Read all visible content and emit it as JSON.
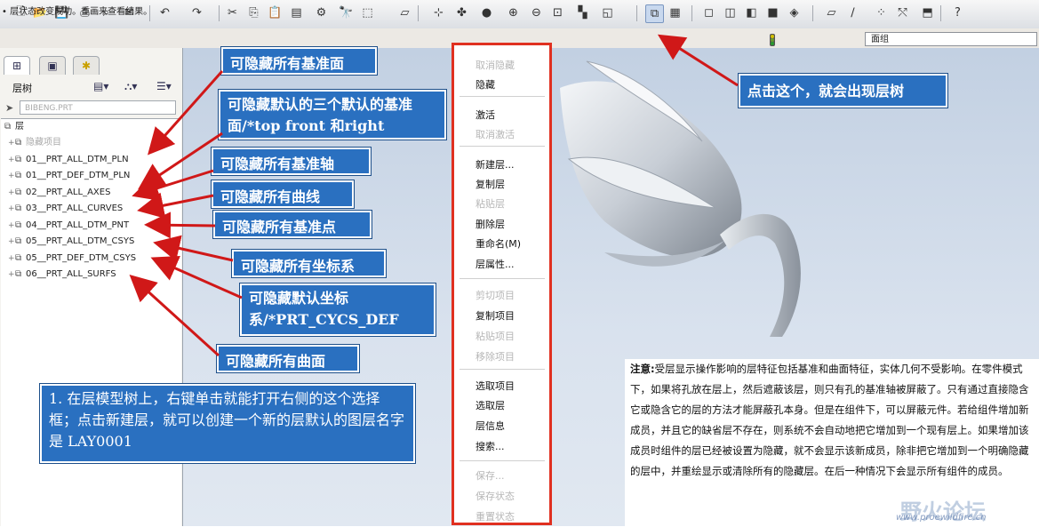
{
  "toolbar": {
    "icons": [
      "new-icon",
      "open-icon",
      "save-icon",
      "print-icon",
      "preview-icon",
      "email-icon",
      "undo-icon",
      "redo-icon",
      "cut-icon",
      "copy-icon",
      "paste-icon",
      "paste-special-icon",
      "regenerate-icon",
      "find-icon",
      "select-box-icon",
      "repaint-icon",
      "spin-center-icon",
      "orient-icon",
      "appearance-icon",
      "zoom-in-icon",
      "zoom-out-icon",
      "refit-icon",
      "view-mgr-icon",
      "saved-views-icon",
      "layer-tree-icon",
      "model-tree-settings-icon",
      "wireframe-icon",
      "hidden-line-icon",
      "no-hidden-icon",
      "shaded-icon",
      "shading-icon",
      "datum-plane-icon",
      "datum-axis-icon",
      "datum-point-icon",
      "csys-icon",
      "annotations-icon",
      "help-icon"
    ],
    "highlight_color": "#c8d8ee"
  },
  "status": {
    "message": "• 层状态改变成功。重画来查看结果。",
    "filter_value": "面组"
  },
  "left_panel": {
    "tabs": [
      "model-tree-tab-icon",
      "folder-tab-icon",
      "favorites-tab-icon"
    ],
    "title": "层树",
    "model_name": "BIBENG.PRT",
    "root_label": "层",
    "rows": [
      {
        "label": "隐藏项目",
        "dim": true
      },
      {
        "label": "01__PRT_ALL_DTM_PLN",
        "dim": false
      },
      {
        "label": "01__PRT_DEF_DTM_PLN",
        "dim": false
      },
      {
        "label": "02__PRT_ALL_AXES",
        "dim": false
      },
      {
        "label": "03__PRT_ALL_CURVES",
        "dim": false
      },
      {
        "label": "04__PRT_ALL_DTM_PNT",
        "dim": false
      },
      {
        "label": "05__PRT_ALL_DTM_CSYS",
        "dim": false
      },
      {
        "label": "05__PRT_DEF_DTM_CSYS",
        "dim": false
      },
      {
        "label": "06__PRT_ALL_SURFS",
        "dim": false
      }
    ]
  },
  "context_menu": {
    "items": [
      {
        "label": "取消隐藏",
        "enabled": false
      },
      {
        "label": "隐藏",
        "enabled": true
      },
      {
        "label": "激活",
        "enabled": true
      },
      {
        "label": "取消激活",
        "enabled": false
      },
      {
        "label": "新建层...",
        "enabled": true
      },
      {
        "label": "复制层",
        "enabled": true
      },
      {
        "label": "粘贴层",
        "enabled": false
      },
      {
        "label": "删除层",
        "enabled": true
      },
      {
        "label": "重命名(M)",
        "enabled": true
      },
      {
        "label": "层属性...",
        "enabled": true
      },
      {
        "label": "剪切项目",
        "enabled": false
      },
      {
        "label": "复制项目",
        "enabled": true
      },
      {
        "label": "粘贴项目",
        "enabled": false
      },
      {
        "label": "移除项目",
        "enabled": false
      },
      {
        "label": "选取项目",
        "enabled": true
      },
      {
        "label": "选取层",
        "enabled": true
      },
      {
        "label": "层信息",
        "enabled": true
      },
      {
        "label": "搜索...",
        "enabled": true
      },
      {
        "label": "保存...",
        "enabled": false
      },
      {
        "label": "保存状态",
        "enabled": false
      },
      {
        "label": "重置状态",
        "enabled": false
      }
    ],
    "border_color": "#e03020"
  },
  "callouts": {
    "c1": "可隐藏所有基准面",
    "c2": "可隐藏默认的三个默认的基准面/*top front 和right",
    "c3": "可隐藏所有基准轴",
    "c4": "可隐藏所有曲线",
    "c5": "可隐藏所有基准点",
    "c6": "可隐藏所有坐标系",
    "c7": "可隐藏默认坐标系/*PRT_CYCS_DEF",
    "c8": "可隐藏所有曲面",
    "c9": "1. 在层模型树上，右键单击就能打开右侧的这个选择框；点击新建层，就可以创建一个新的层默认的图层名字是 LAY0001",
    "c10": "点击这个，就会出现层树",
    "color": "#2a70c0"
  },
  "note": {
    "bold": "注意:",
    "text": "受层显示操作影响的层特征包括基准和曲面特征，实体几何不受影响。在零件模式下，如果将孔放在层上，然后遮蔽该层，则只有孔的基准轴被屏蔽了。只有通过直接隐含它或隐含它的层的方法才能屏蔽孔本身。但是在组件下，可以屏蔽元件。若给组件增加新成员，并且它的缺省层不存在，则系统不会自动地把它增加到一个现有层上。如果增加该成员时组件的层已经被设置为隐藏，就不会显示该新成员，除非把它增加到一个明确隐藏的层中，并重绘显示或清除所有的隐藏层。在后一种情况下会显示所有组件的成员。"
  },
  "watermark": {
    "text": "野火论坛",
    "url": "www.proewildfire.cn"
  }
}
